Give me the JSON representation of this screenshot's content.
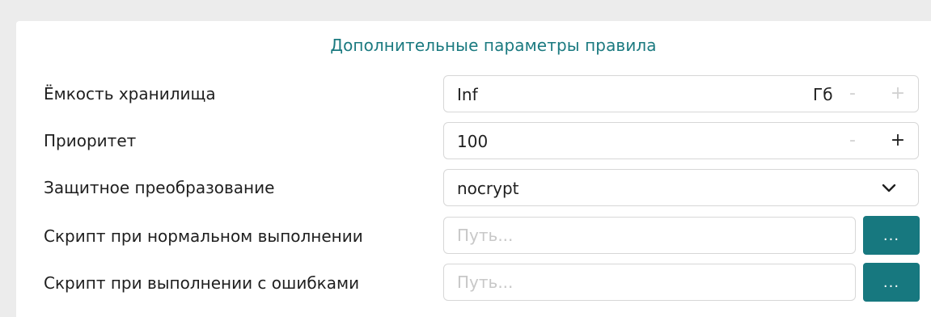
{
  "section": {
    "title": "Дополнительные параметры правила"
  },
  "rows": {
    "capacity": {
      "label": "Ёмкость хранилища",
      "value": "Inf",
      "unit": "Гб",
      "minus": "-",
      "plus": "+"
    },
    "priority": {
      "label": "Приоритет",
      "value": "100",
      "minus": "-",
      "plus": "+"
    },
    "transform": {
      "label": "Защитное преобразование",
      "selected": "nocrypt",
      "icon": "chevron-down-icon"
    },
    "script_ok": {
      "label": "Скрипт при нормальном выполнении",
      "placeholder": "Путь...",
      "value": "",
      "button": "..."
    },
    "script_err": {
      "label": "Скрипт при выполнении с ошибками",
      "placeholder": "Путь...",
      "value": "",
      "button": "..."
    }
  },
  "colors": {
    "accent": "#17787f",
    "title": "#1b7a80",
    "disabled": "#d2d2d2"
  }
}
